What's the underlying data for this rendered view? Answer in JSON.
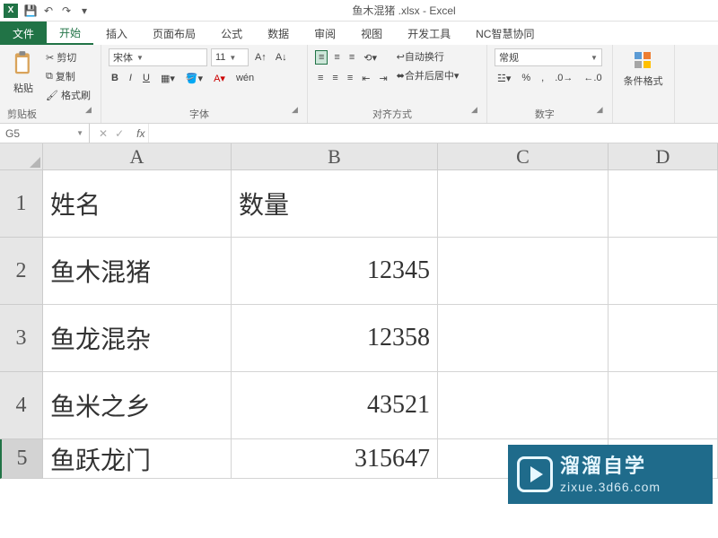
{
  "title": "鱼木混猪 .xlsx - Excel",
  "qat": {
    "save": "💾",
    "undo": "↶",
    "redo": "↷"
  },
  "tabs": {
    "file": "文件",
    "items": [
      "开始",
      "插入",
      "页面布局",
      "公式",
      "数据",
      "审阅",
      "视图",
      "开发工具",
      "NC智慧协同"
    ],
    "active": 0
  },
  "ribbon": {
    "clipboard": {
      "paste": "粘贴",
      "cut": "剪切",
      "copy": "复制",
      "format_painter": "格式刷",
      "label": "剪贴板"
    },
    "font": {
      "name": "宋体",
      "size": "11",
      "bold": "B",
      "italic": "I",
      "underline": "U",
      "wen": "wén",
      "label": "字体"
    },
    "align": {
      "wrap": "自动换行",
      "merge": "合并后居中",
      "label": "对齐方式"
    },
    "number": {
      "format": "常规",
      "label": "数字"
    },
    "cond": {
      "label": "条件格式"
    }
  },
  "namebox": "G5",
  "columns": [
    "A",
    "B",
    "C",
    "D"
  ],
  "rows": [
    {
      "n": "1",
      "A": "姓名",
      "B": "数量",
      "btype": "text"
    },
    {
      "n": "2",
      "A": "鱼木混猪",
      "B": "12345",
      "btype": "num"
    },
    {
      "n": "3",
      "A": "鱼龙混杂",
      "B": "12358",
      "btype": "num"
    },
    {
      "n": "4",
      "A": "鱼米之乡",
      "B": "43521",
      "btype": "num"
    },
    {
      "n": "5",
      "A": "鱼跃龙门",
      "B": "315647",
      "btype": "num",
      "partial": true
    }
  ],
  "watermark": {
    "big": "溜溜自学",
    "small": "zixue.3d66.com"
  }
}
